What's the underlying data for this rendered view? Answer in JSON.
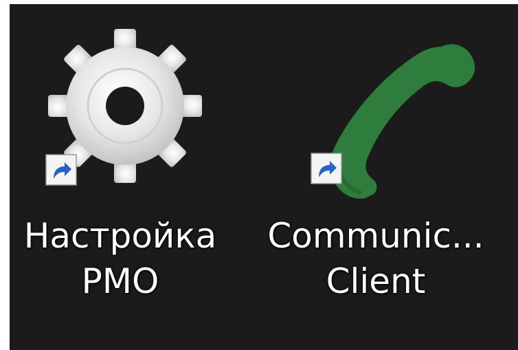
{
  "desktop": {
    "background": "#1b1b1b",
    "shortcuts": [
      {
        "icon": "gear-icon",
        "badge": "shortcut-arrow-icon",
        "label_line_1": "Настройка",
        "label_line_2": "PMO"
      },
      {
        "icon": "phone-handset-icon",
        "icon_color": "#2e7d3c",
        "badge": "shortcut-arrow-icon",
        "label_line_1": "Communic...",
        "label_line_2": "Client"
      }
    ]
  }
}
